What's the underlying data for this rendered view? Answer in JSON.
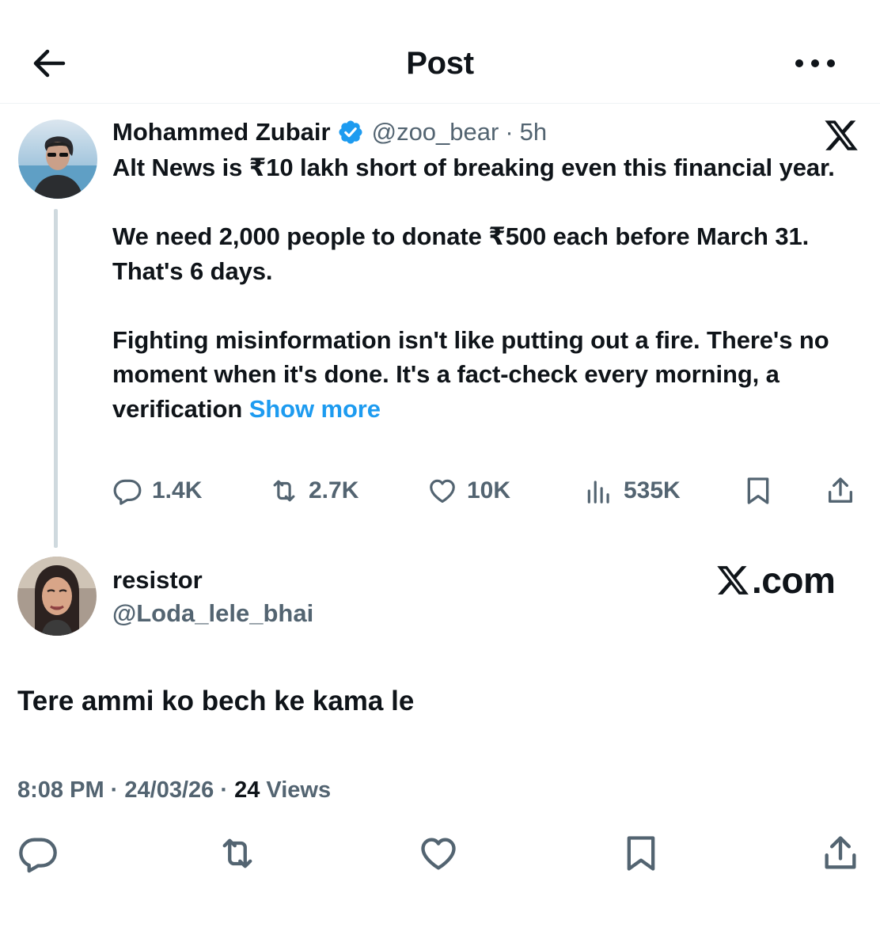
{
  "header": {
    "title": "Post",
    "back_icon": "arrow-left-icon",
    "more_icon": "more-horizontal-icon"
  },
  "quoted_post": {
    "author_name": "Mohammed Zubair",
    "verified": true,
    "handle": "@zoo_bear",
    "separator": "·",
    "time": "5h",
    "brand_logo": "x-logo-icon",
    "text": "Alt News is ₹10 lakh short of breaking even this financial year.\n\nWe need 2,000 people to donate ₹500 each before March 31. That's 6 days.\n\nFighting misinformation isn't like putting out a fire. There's no moment when it's done. It's a fact-check every morning, a verification ",
    "show_more": "Show more",
    "stats": {
      "replies": "1.4K",
      "reposts": "2.7K",
      "likes": "10K",
      "views": "535K"
    }
  },
  "reply_post": {
    "author_name": "resistor",
    "handle": "@Loda_lele_bhai",
    "watermark": ".com",
    "text": "Tere ammi ko bech ke kama le",
    "time": "8:08 PM",
    "date": "24/03/26",
    "sep1": " · ",
    "sep2": " · ",
    "views_count": "24",
    "views_label": " Views"
  },
  "colors": {
    "accent": "#1d9bf0",
    "text": "#0f1419",
    "secondary": "#536471",
    "divider": "#eff3f4",
    "thread_line": "#cfd9de"
  }
}
